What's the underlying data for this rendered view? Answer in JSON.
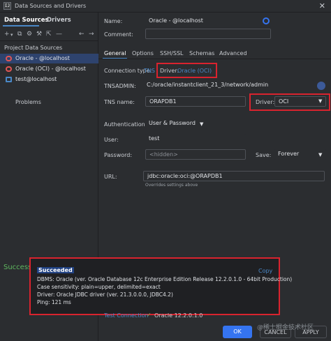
{
  "window": {
    "title": "Data Sources and Drivers",
    "app_icon": "IJ"
  },
  "left": {
    "tabs": [
      "Data Sources",
      "Drivers"
    ],
    "section_title": "Project Data Sources",
    "items": [
      {
        "label": "Oracle - @localhost",
        "icon": "oracle-db-icon"
      },
      {
        "label": "Oracle (OCI) - @localhost",
        "icon": "oracle-db-icon"
      },
      {
        "label": "test@localhost",
        "icon": "db-icon"
      }
    ],
    "problems": "Problems"
  },
  "form": {
    "name_label": "Name:",
    "name_value": "Oracle - @localhost",
    "comment_label": "Comment:",
    "tabs": [
      "General",
      "Options",
      "SSH/SSL",
      "Schemas",
      "Advanced"
    ],
    "connection_type_label": "Connection type:",
    "connection_type_value": "TNS",
    "driver_label": "Driver:",
    "driver_value": "Oracle (OCI)",
    "tnsadmin_label": "TNSADMIN:",
    "tnsadmin_value": "C:/oracle/instantclient_21_3/network/admin",
    "tnsname_label": "TNS name:",
    "tnsname_value": "ORAPDB1",
    "driver2_label": "Driver:",
    "driver2_value": "OCI",
    "auth_label": "Authentication:",
    "auth_value": "User & Password",
    "user_label": "User:",
    "user_value": "test",
    "password_label": "Password:",
    "password_value": "<hidden>",
    "save_label": "Save:",
    "save_value": "Forever",
    "url_label": "URL:",
    "url_value": "jdbc:oracle:oci:@ORAPDB1",
    "url_hint": "Overrides settings above"
  },
  "side_note": "Success",
  "popup": {
    "title": "Succeeded",
    "copy": "Copy",
    "lines": [
      "DBMS: Oracle (ver. Oracle Database 12c Enterprise Edition Release 12.2.0.1.0 - 64bit Production)",
      "Case sensitivity: plain=upper, delimited=exact",
      "Driver: Oracle JDBC driver (ver. 21.3.0.0.0, JDBC4.2)",
      "Ping: 121 ms"
    ]
  },
  "footer": {
    "test_connection": "Test Connection",
    "test_result": "Oracle 12.2.0.1.0",
    "ok": "OK",
    "cancel": "CANCEL",
    "apply": "APPLY",
    "watermark": "@稀土掘金技术社区"
  }
}
